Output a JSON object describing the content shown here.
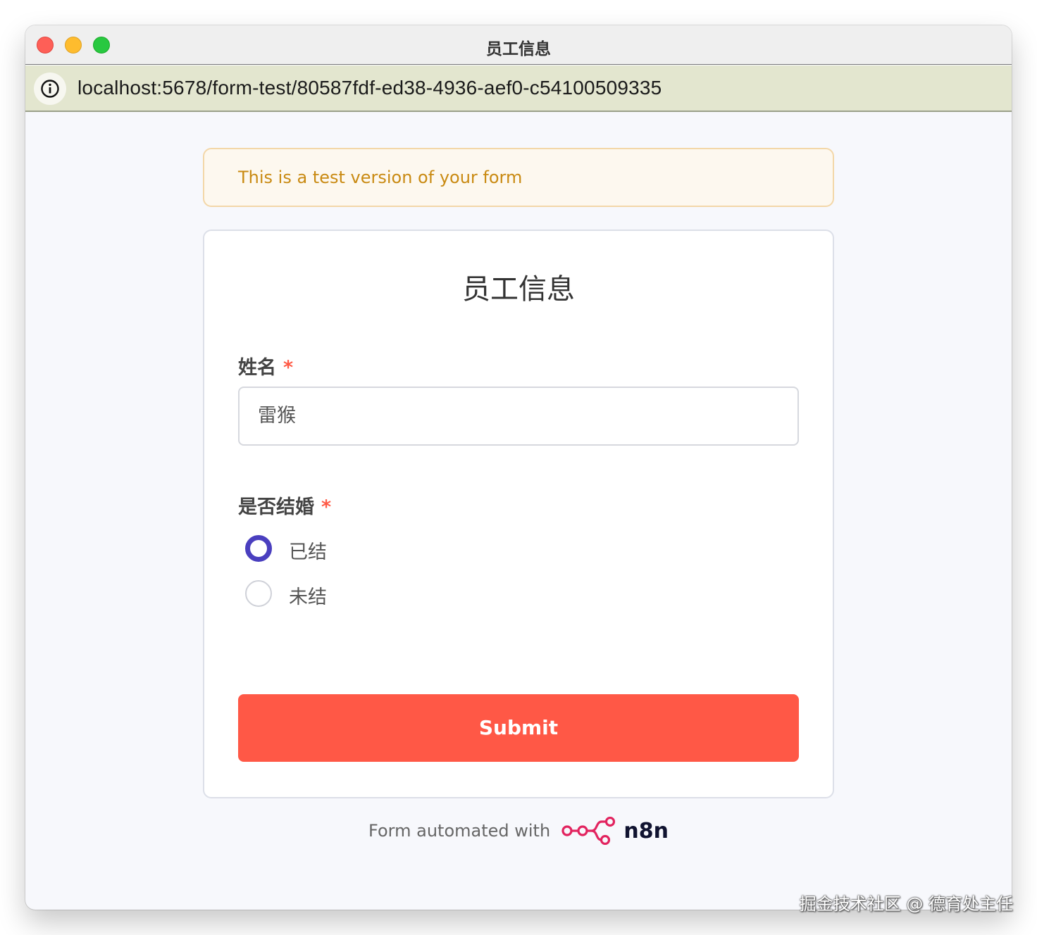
{
  "window": {
    "title": "员工信息"
  },
  "addressbar": {
    "url": "localhost:5678/form-test/80587fdf-ed38-4936-aef0-c54100509335",
    "info_icon": "info-icon"
  },
  "banner": {
    "text": "This is a test version of your form"
  },
  "form": {
    "title": "员工信息",
    "fields": [
      {
        "label": "姓名",
        "required_mark": "*",
        "value": "雷猴"
      },
      {
        "label": "是否结婚",
        "required_mark": "*",
        "options": [
          {
            "label": "已结",
            "selected": true
          },
          {
            "label": "未结",
            "selected": false
          }
        ]
      }
    ],
    "submit_label": "Submit"
  },
  "footer": {
    "text": "Form automated with",
    "brand": "n8n"
  },
  "watermark": "掘金技术社区 @ 德育处主任",
  "colors": {
    "accent": "#ff5846",
    "radio_selected": "#4a3fbf",
    "banner_text": "#c98a12",
    "required": "#ff5a46",
    "n8n_logo": "#e2245f"
  }
}
